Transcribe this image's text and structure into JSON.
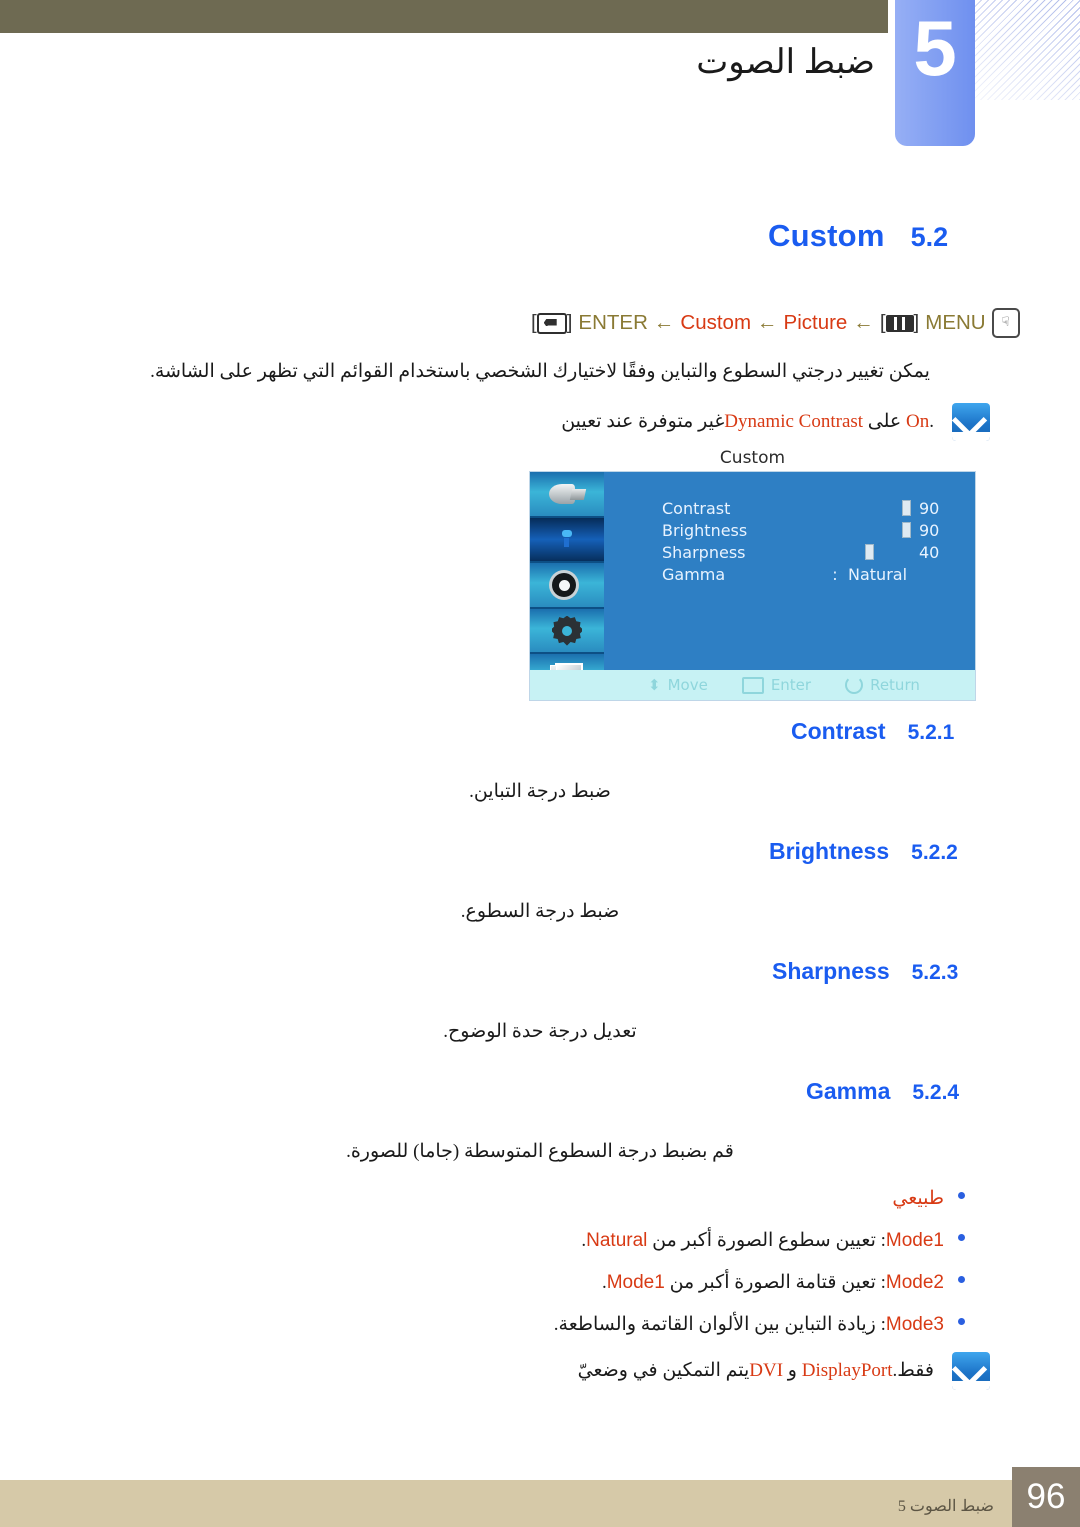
{
  "chapter": {
    "number": "5",
    "title": "ضبط الصوت"
  },
  "section": {
    "title": "Custom",
    "number": "5.2"
  },
  "breadcrumb": {
    "enter_label": "ENTER",
    "arrow1": "←",
    "custom": "Custom",
    "arrow2": "←",
    "picture": "Picture",
    "arrow3": "←",
    "bracket_open": "[",
    "bracket_close": "]",
    "menu_label": "MENU",
    "hand_glyph": "☟"
  },
  "intro_text": "يمكن تغيير درجتي السطوع والتباين وفقًا لاختيارك الشخصي باستخدام القوائم التي تظهر على الشاشة.",
  "note_top": {
    "prefix": "غير متوفرة عند تعيين ",
    "term": "Dynamic Contrast",
    "middle": " على ",
    "value": "On",
    "suffix": "."
  },
  "osd": {
    "title": "Custom",
    "rows": [
      {
        "label": "Contrast",
        "value": "90",
        "type": "slider",
        "pos": 82
      },
      {
        "label": "Brightness",
        "value": "90",
        "type": "slider",
        "pos": 82
      },
      {
        "label": "Sharpness",
        "value": "40",
        "type": "slider",
        "pos": 44
      },
      {
        "label": "Gamma",
        "value": "Natural",
        "type": "option",
        "colon": ":"
      }
    ],
    "bottom_bar": {
      "move": "Move",
      "enter": "Enter",
      "return": "Return"
    },
    "side_icons": [
      "picture-icon",
      "color-icon",
      "sound-icon",
      "setup-icon",
      "display-icon"
    ]
  },
  "subsections": [
    {
      "title": "Contrast",
      "number": "5.2.1",
      "body": "ضبط درجة التباين."
    },
    {
      "title": "Brightness",
      "number": "5.2.2",
      "body": "ضبط درجة السطوع."
    },
    {
      "title": "Sharpness",
      "number": "5.2.3",
      "body": "تعديل درجة حدة الوضوح."
    },
    {
      "title": "Gamma",
      "number": "5.2.4",
      "body": "قم بضبط درجة السطوع المتوسطة (جاما) للصورة."
    }
  ],
  "gamma_options": [
    {
      "term_ar": "طبيعي",
      "term": "",
      "text": ""
    },
    {
      "term": "Mode1",
      "text": ": تعيين سطوع الصورة أكبر من ",
      "ref": "Natural",
      "end": "."
    },
    {
      "term": "Mode2",
      "text": ": تعين قتامة الصورة أكبر من ",
      "ref": "Mode1",
      "end": "."
    },
    {
      "term": "Mode3",
      "text": ": زيادة التباين بين الألوان القاتمة والساطعة.",
      "ref": "",
      "end": ""
    }
  ],
  "note_bottom": {
    "prefix": "يتم التمكين في وضعيّ ",
    "term1": "DVI",
    "conj": " و ",
    "term2": "DisplayPort",
    "suffix": " فقط."
  },
  "footer": {
    "text": "ضبط الصوت 5",
    "page": "96"
  },
  "colors": {
    "heading_blue": "#1a5cf0",
    "accent_red": "#d83a14",
    "crumb_gold": "#8a7a34",
    "olive": "#6e6a52",
    "footer_tan": "#d6c9a8",
    "osd_blue": "#2e7fc4"
  }
}
